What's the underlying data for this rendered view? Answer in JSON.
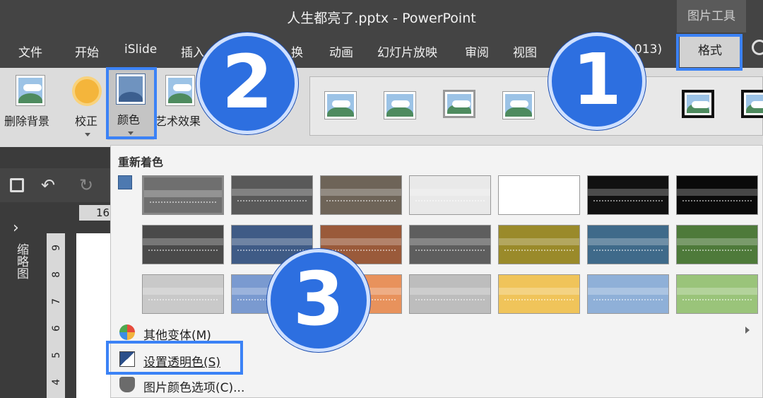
{
  "window": {
    "title": "人生都亮了.pptx  -  PowerPoint",
    "context_group": "图片工具"
  },
  "tabs": [
    {
      "label": "文件"
    },
    {
      "label": "开始"
    },
    {
      "label": "iSlide"
    },
    {
      "label": "插入"
    },
    {
      "label": "换"
    },
    {
      "label": "动画"
    },
    {
      "label": "幻灯片放映"
    },
    {
      "label": "审阅"
    },
    {
      "label": "视图"
    },
    {
      "label": "013)"
    }
  ],
  "format_tab": "格式",
  "ribbon": {
    "remove_bg": "删除背景",
    "correct": "校正",
    "color": "颜色",
    "art_effects": "艺术效果"
  },
  "ruler": {
    "h_value": "16",
    "v_ticks": [
      "9",
      "8",
      "7",
      "6",
      "5",
      "4"
    ]
  },
  "thumbnail_pane": {
    "label": "缩略图"
  },
  "dropdown": {
    "heading": "重新着色",
    "swatch_colors": [
      [
        "#6f6f6f",
        "#595959",
        "#6e6458",
        "#e9e9e9",
        "#ffffff",
        "#111111",
        "#0a0a0a"
      ],
      [
        "#4a4a4a",
        "#3f5b86",
        "#9a5a3a",
        "#5e5e5e",
        "#9a8a2a",
        "#3f6a8a",
        "#4e7a3a"
      ],
      [
        "#c9c9c9",
        "#7a9ad0",
        "#e8925c",
        "#bdbdbd",
        "#f0c45a",
        "#8fb0d8",
        "#9ac47a"
      ]
    ],
    "items": [
      {
        "label": "其他变体(M)"
      },
      {
        "label": "设置透明色(S)"
      },
      {
        "label": "图片颜色选项(C)..."
      }
    ]
  },
  "steps": [
    "1",
    "2",
    "3"
  ]
}
